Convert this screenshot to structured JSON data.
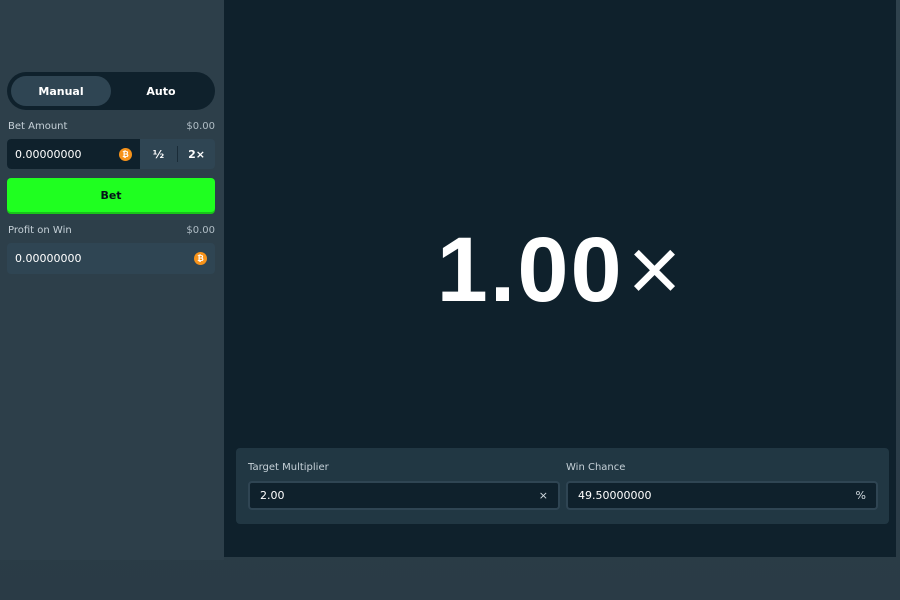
{
  "sidebar": {
    "tabs": [
      {
        "label": "Manual",
        "active": true
      },
      {
        "label": "Auto",
        "active": false
      }
    ],
    "bet_amount": {
      "label": "Bet Amount",
      "usd_value": "$0.00",
      "value": "0.00000000",
      "currency_icon": "bitcoin-icon",
      "half_label": "½",
      "double_label": "2×"
    },
    "bet_button_label": "Bet",
    "profit_on_win": {
      "label": "Profit on Win",
      "usd_value": "$0.00",
      "value": "0.00000000",
      "currency_icon": "bitcoin-icon"
    }
  },
  "game": {
    "result_value": "1.00",
    "result_suffix": "×",
    "target_multiplier": {
      "label": "Target Multiplier",
      "value": "2.00",
      "suffix": "×"
    },
    "win_chance": {
      "label": "Win Chance",
      "value": "49.50000000",
      "suffix": "%"
    }
  },
  "colors": {
    "bet_button": "#1fff20",
    "background": "#0f212c",
    "panel": "#2f4553",
    "coin": "#f7931a"
  }
}
